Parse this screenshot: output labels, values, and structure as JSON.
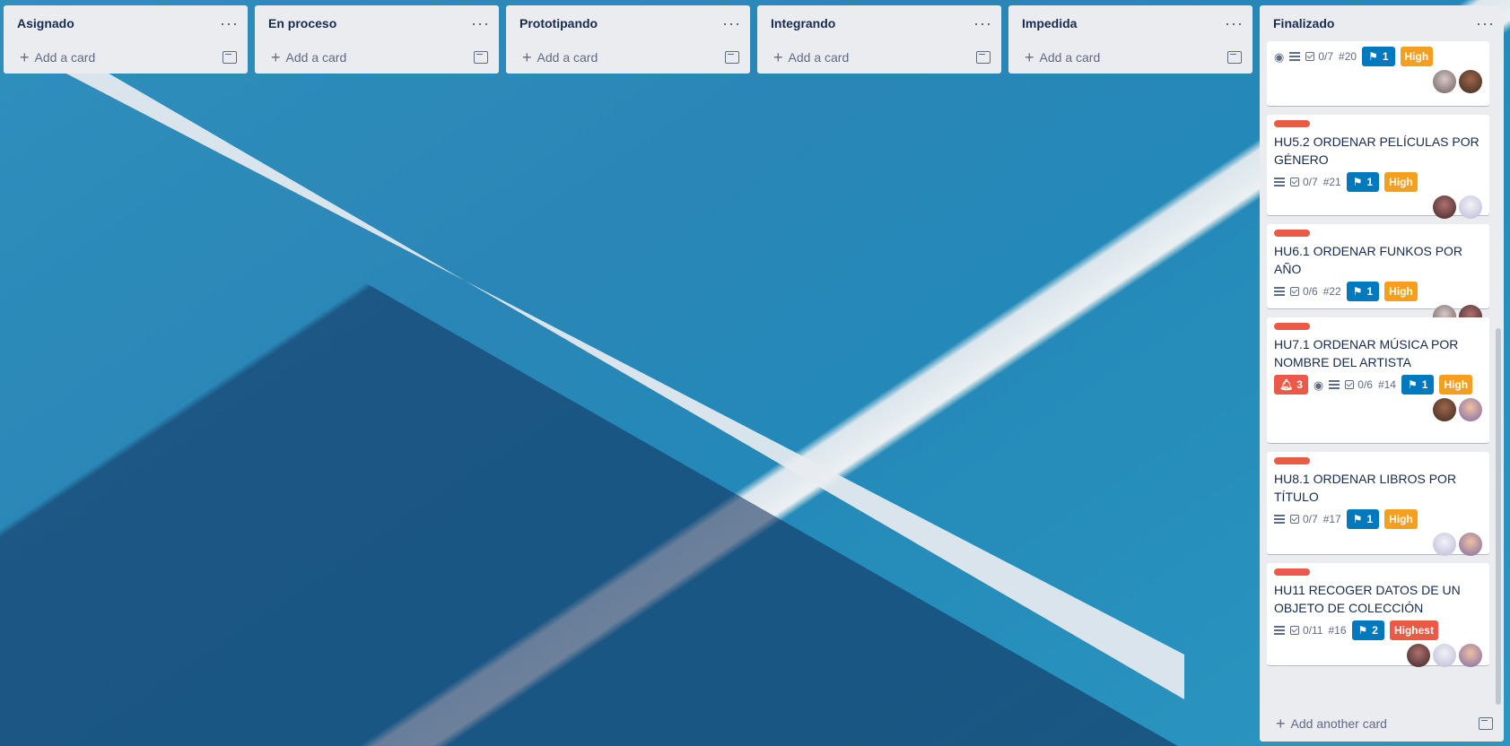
{
  "lists": [
    {
      "title": "Asignado",
      "add_card": "Add a card"
    },
    {
      "title": "En proceso",
      "add_card": "Add a card"
    },
    {
      "title": "Prototipando",
      "add_card": "Add a card"
    },
    {
      "title": "Integrando",
      "add_card": "Add a card"
    },
    {
      "title": "Impedida",
      "add_card": "Add a card"
    }
  ],
  "done_list": {
    "title": "Finalizado",
    "add_another": "Add another card",
    "cards": [
      {
        "title": "",
        "checklist": "0/7",
        "number": "#20",
        "flags": "1",
        "priority": "High",
        "priority_color": "#f59f1e"
      },
      {
        "title": "HU5.2 ORDENAR PELÍCULAS POR GÉNERO",
        "checklist": "0/7",
        "number": "#21",
        "flags": "1",
        "priority": "High",
        "priority_color": "#f59f1e"
      },
      {
        "title": "HU6.1 ORDENAR FUNKOS POR AÑO",
        "checklist": "0/6",
        "number": "#22",
        "flags": "1",
        "priority": "High",
        "priority_color": "#f59f1e"
      },
      {
        "title": "HU7.1 ORDENAR MÚSICA POR NOMBRE DEL ARTISTA",
        "notifications": "3",
        "checklist": "0/6",
        "number": "#14",
        "flags": "1",
        "priority": "High",
        "priority_color": "#f59f1e"
      },
      {
        "title": "HU8.1 ORDENAR LIBROS POR TÍTULO",
        "checklist": "0/7",
        "number": "#17",
        "flags": "1",
        "priority": "High",
        "priority_color": "#f59f1e"
      },
      {
        "title": "HU11 RECOGER DATOS DE UN OBJETO DE COLECCIÓN",
        "checklist": "0/11",
        "number": "#16",
        "flags": "2",
        "priority": "Highest",
        "priority_color": "#eb5a46"
      }
    ]
  },
  "colors": {
    "list_bg": "#ebecf0",
    "label_red": "#eb5a46",
    "flag_blue": "#0079bf",
    "priority_high": "#f59f1e",
    "priority_highest": "#eb5a46"
  },
  "icons": [
    "dots-menu-icon",
    "plus-icon",
    "template-icon",
    "eye-icon",
    "description-icon",
    "checklist-icon",
    "flag-icon",
    "bell-icon"
  ]
}
